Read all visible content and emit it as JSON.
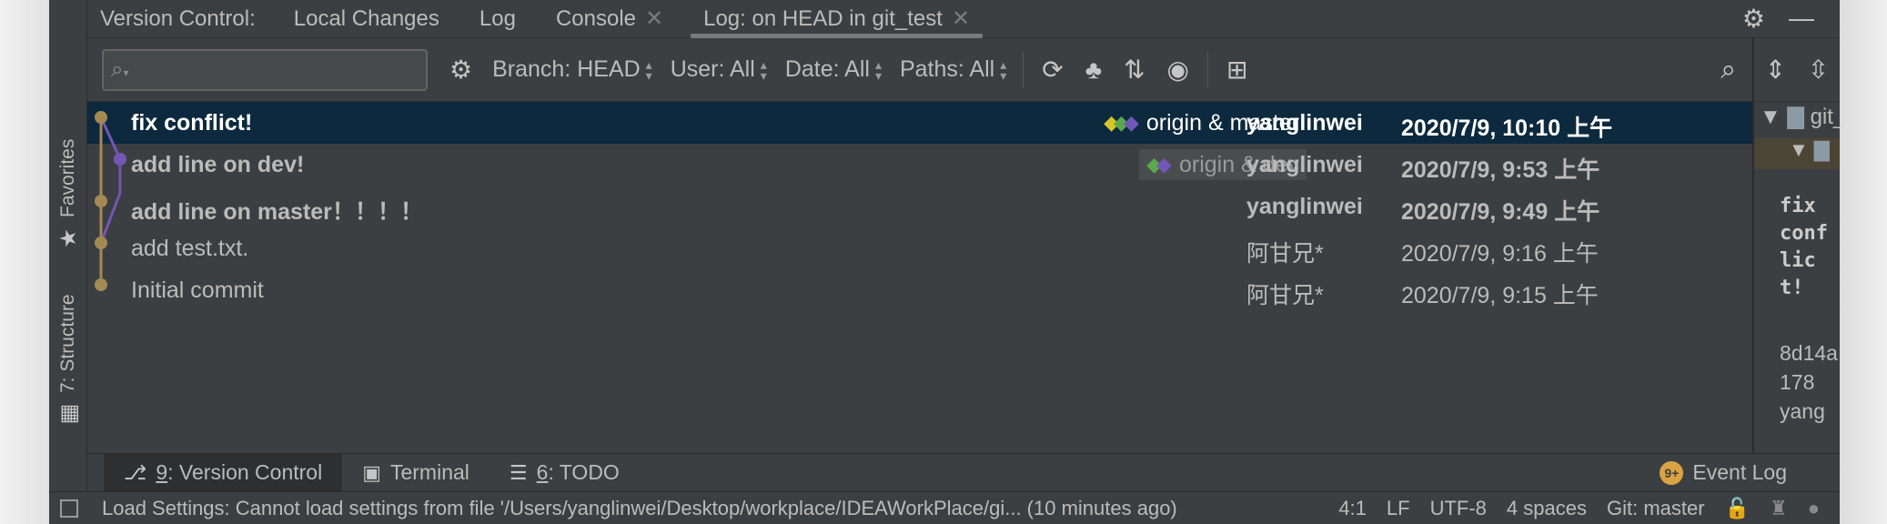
{
  "header": {
    "title": "Version Control:",
    "tabs": [
      {
        "label": "Local Changes",
        "closable": false,
        "active": false
      },
      {
        "label": "Log",
        "closable": false,
        "active": false
      },
      {
        "label": "Console",
        "closable": true,
        "active": false
      },
      {
        "label": "Log: on HEAD in git_test",
        "closable": true,
        "active": true
      }
    ],
    "icons": [
      "gear-icon",
      "minimize-icon"
    ]
  },
  "side_stripe": {
    "favorites": "Favorites",
    "structure": "7: Structure"
  },
  "toolbar": {
    "search_placeholder": "",
    "filters": {
      "branch": "Branch: HEAD",
      "user": "User: All",
      "date": "Date: All",
      "paths": "Paths: All"
    },
    "icons": [
      "gear-icon",
      "refresh-icon",
      "cherry-pick-icon",
      "sort-icon",
      "eye-icon",
      "new-tab-icon",
      "search-icon"
    ]
  },
  "commits": [
    {
      "message": "fix conflict!",
      "ref": "origin & master",
      "author": "yanglinwei",
      "date": "2020/7/9, 10:10 上午",
      "bold": true,
      "selected": true
    },
    {
      "message": "add line on dev!",
      "ref": "origin & dev",
      "author": "yanglinwei",
      "date": "2020/7/9, 9:53 上午",
      "bold": true,
      "selected": false
    },
    {
      "message": "add line on master！！！！",
      "ref": "",
      "author": "yanglinwei",
      "date": "2020/7/9, 9:49 上午",
      "bold": true,
      "selected": false
    },
    {
      "message": "add test.txt.",
      "ref": "",
      "author": "阿甘兄*",
      "date": "2020/7/9, 9:16 上午",
      "bold": false,
      "selected": false
    },
    {
      "message": "Initial commit",
      "ref": "",
      "author": "阿甘兄*",
      "date": "2020/7/9, 9:15 上午",
      "bold": false,
      "selected": false
    }
  ],
  "details": {
    "tree_root": "git_",
    "tree_child": "",
    "message": "fix conflict!",
    "hash_fragment": "8d14a178",
    "author_fragment": "yang"
  },
  "bottom_tabs": [
    {
      "mnemonic": "9",
      "label": ": Version Control",
      "active": true,
      "icon": "vcs-icon"
    },
    {
      "mnemonic": "",
      "label": "Terminal",
      "active": false,
      "icon": "terminal-icon"
    },
    {
      "mnemonic": "6",
      "label": ": TODO",
      "active": false,
      "icon": "todo-icon"
    }
  ],
  "event_log": {
    "label": "Event Log",
    "badge": "9+"
  },
  "status": {
    "message": "Load Settings: Cannot load settings from file '/Users/yanglinwei/Desktop/workplace/IDEAWorkPlace/gi... (10 minutes ago)",
    "position": "4:1",
    "line_ending": "LF",
    "encoding": "UTF-8",
    "indent": "4 spaces",
    "vcs": "Git: master"
  },
  "colors": {
    "graph_main": "#a38a55",
    "graph_branch": "#7257b5",
    "selection": "#0d293e",
    "tag_yellow": "#d7c42b",
    "tag_green": "#5ba84f"
  }
}
